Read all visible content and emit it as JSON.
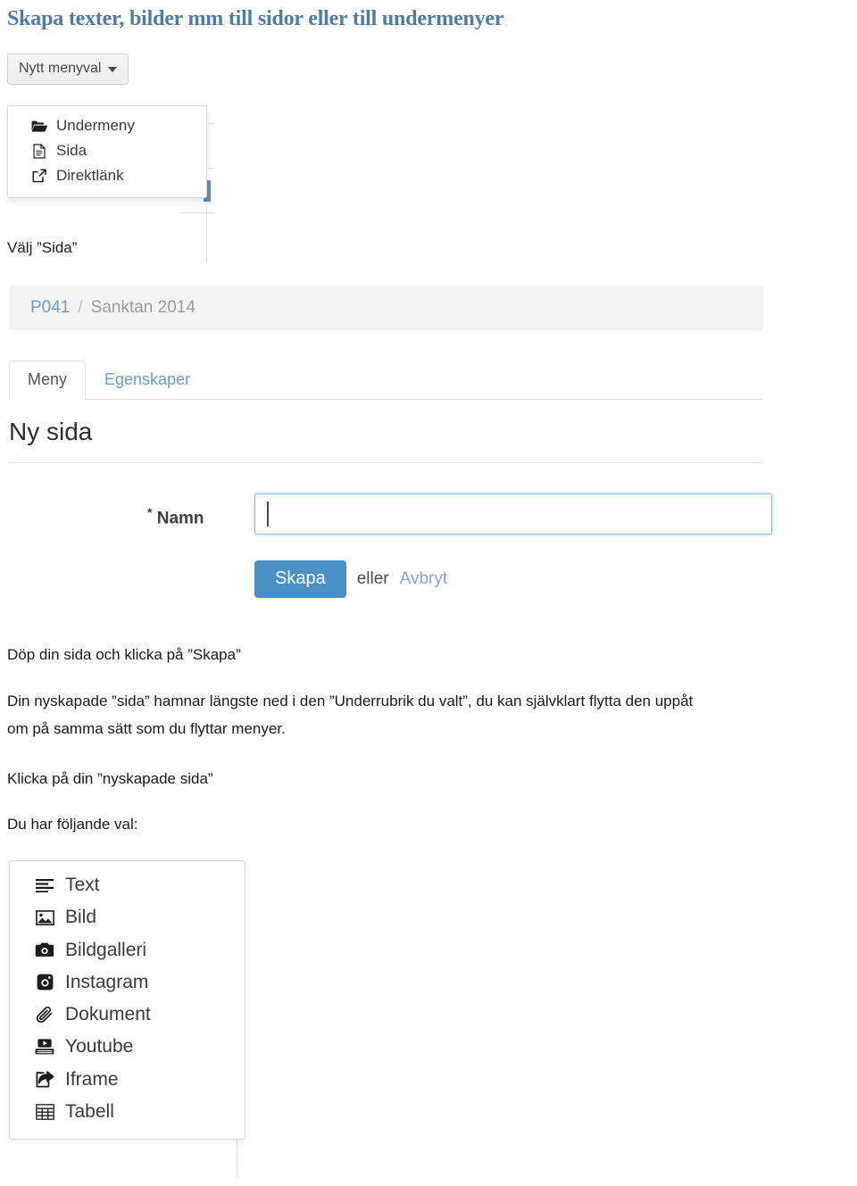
{
  "document": {
    "title": "Skapa texter, bilder mm till sidor eller till undermenyer"
  },
  "new_menu_button": {
    "label": "Nytt menyval",
    "caret_icon": "caret-down-icon"
  },
  "new_menu_dropdown": {
    "items": [
      {
        "label": "Undermeny",
        "icon": "folder-open-icon"
      },
      {
        "label": "Sida",
        "icon": "file-document-icon"
      },
      {
        "label": "Direktlänk",
        "icon": "external-link-icon"
      }
    ]
  },
  "instructions": {
    "choose_sida": "Välj ”Sida”",
    "name_and_create": "Döp din sida och klicka på ”Skapa”",
    "placement_line1": "Din nyskapade ”sida” hamnar längste ned i den ”Underrubrik du valt”, du kan självklart flytta den uppåt",
    "placement_line2": "om på samma sätt som du flyttar menyer.",
    "click_new_page": "Klicka på din ”nyskapade sida”",
    "options_intro": "Du har följande val:"
  },
  "editor": {
    "breadcrumb": {
      "root": "P041",
      "separator": "/",
      "current": "Sanktan 2014"
    },
    "tabs": [
      {
        "label": "Meny",
        "active": true
      },
      {
        "label": "Egenskaper",
        "active": false
      }
    ],
    "section_title": "Ny sida",
    "form": {
      "required_marker": "*",
      "name_label": "Namn",
      "name_value": "",
      "name_placeholder": ""
    },
    "actions": {
      "submit_label": "Skapa",
      "or_label": "eller",
      "cancel_label": "Avbryt"
    }
  },
  "content_types": {
    "items": [
      {
        "label": "Text",
        "icon": "text-lines-icon"
      },
      {
        "label": "Bild",
        "icon": "image-icon"
      },
      {
        "label": "Bildgalleri",
        "icon": "camera-icon"
      },
      {
        "label": "Instagram",
        "icon": "instagram-icon"
      },
      {
        "label": "Dokument",
        "icon": "paperclip-icon"
      },
      {
        "label": "Youtube",
        "icon": "youtube-icon"
      },
      {
        "label": "Iframe",
        "icon": "share-external-icon"
      },
      {
        "label": "Tabell",
        "icon": "table-grid-icon"
      }
    ]
  },
  "colors": {
    "heading": "#4f7ba8",
    "link": "#6a9ec9",
    "primary_button": "#4a90c4",
    "body_text": "#1a1a1a",
    "muted": "#9b9b9b"
  }
}
